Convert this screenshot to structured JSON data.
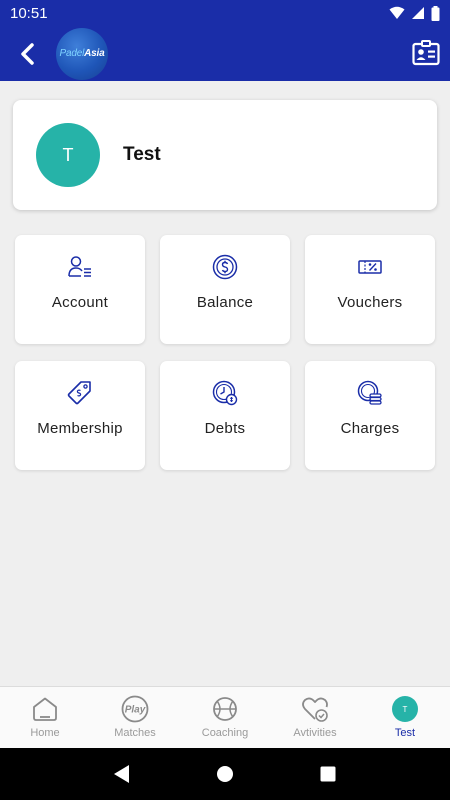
{
  "status_bar": {
    "time": "10:51"
  },
  "app_bar": {
    "logo_text_first": "Padel",
    "logo_text_second": "Asia",
    "back_icon": "arrow-left-icon",
    "right_icon": "id-card-icon"
  },
  "profile": {
    "initial": "T",
    "name": "Test",
    "avatar_color": "#26b3a8"
  },
  "tiles": [
    {
      "label": "Account",
      "icon": "user-list-icon"
    },
    {
      "label": "Balance",
      "icon": "dollar-coin-icon"
    },
    {
      "label": "Vouchers",
      "icon": "percent-ticket-icon"
    },
    {
      "label": "Membership",
      "icon": "price-tag-icon"
    },
    {
      "label": "Debts",
      "icon": "clock-coin-icon"
    },
    {
      "label": "Charges",
      "icon": "coin-stack-icon"
    }
  ],
  "bottom_nav": {
    "items": [
      {
        "label": "Home",
        "icon": "home-icon"
      },
      {
        "label": "Matches",
        "icon": "play-icon"
      },
      {
        "label": "Coaching",
        "icon": "ball-icon"
      },
      {
        "label": "Avtivities",
        "icon": "heart-check-icon"
      },
      {
        "label": "Test",
        "icon": "avatar",
        "initial": "T",
        "active": true
      }
    ]
  },
  "colors": {
    "primary": "#1a2da8",
    "accent": "#26b3a8",
    "background": "#efefef",
    "icon": "#1a2da8"
  }
}
